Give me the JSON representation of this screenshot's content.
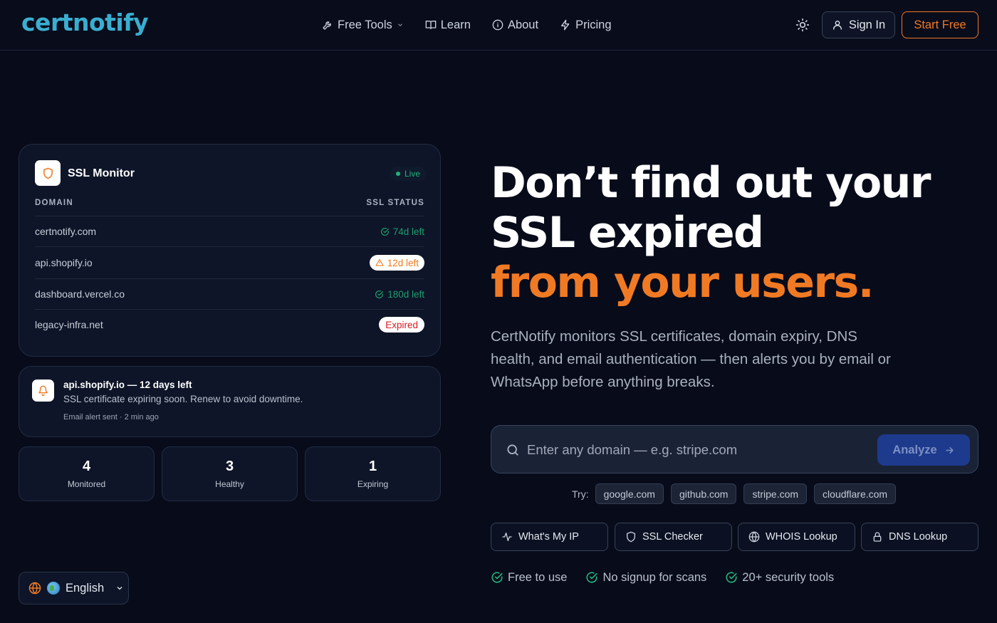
{
  "header": {
    "logo": "certnotify",
    "nav": [
      {
        "label": "Free Tools",
        "icon": "wrench-icon",
        "has_dropdown": true
      },
      {
        "label": "Learn",
        "icon": "book-icon"
      },
      {
        "label": "About",
        "icon": "info-icon"
      },
      {
        "label": "Pricing",
        "icon": "bolt-icon"
      }
    ],
    "sign_in": "Sign In",
    "start_free": "Start Free"
  },
  "monitor": {
    "title": "SSL Monitor",
    "live": "Live",
    "col_domain": "DOMAIN",
    "col_status": "SSL STATUS",
    "rows": [
      {
        "domain": "certnotify.com",
        "status": "74d left",
        "kind": "ok"
      },
      {
        "domain": "api.shopify.io",
        "status": "12d left",
        "kind": "warn"
      },
      {
        "domain": "dashboard.vercel.co",
        "status": "180d left",
        "kind": "ok"
      },
      {
        "domain": "legacy-infra.net",
        "status": "Expired",
        "kind": "expired"
      }
    ]
  },
  "alert": {
    "title": "api.shopify.io — 12 days left",
    "message": "SSL certificate expiring soon. Renew to avoid downtime.",
    "meta": "Email alert sent · 2 min ago"
  },
  "stats": [
    {
      "value": "4",
      "label": "Monitored"
    },
    {
      "value": "3",
      "label": "Healthy"
    },
    {
      "value": "1",
      "label": "Expiring"
    }
  ],
  "language": {
    "label": "English"
  },
  "hero": {
    "line1": "Don’t find out your",
    "line2": "SSL expired",
    "accent": "from your users.",
    "subtitle": "CertNotify monitors SSL certificates, domain expiry, DNS health, and email authentication — then alerts you by email or WhatsApp before anything breaks."
  },
  "search": {
    "placeholder": "Enter any domain — e.g. stripe.com",
    "button": "Analyze"
  },
  "try": {
    "label": "Try:",
    "chips": [
      "google.com",
      "github.com",
      "stripe.com",
      "cloudflare.com"
    ]
  },
  "tools": [
    {
      "label": "What's My IP",
      "icon": "activity-icon"
    },
    {
      "label": "SSL Checker",
      "icon": "shield-icon"
    },
    {
      "label": "WHOIS Lookup",
      "icon": "globe-icon"
    },
    {
      "label": "DNS Lookup",
      "icon": "lock-icon"
    }
  ],
  "features": [
    "Free to use",
    "No signup for scans",
    "20+ security tools"
  ],
  "colors": {
    "background": "#070b1a",
    "accent_orange": "#f07a24",
    "logo_blue": "#3aaed0",
    "success_green": "#1f9d6e",
    "danger_red": "#d81c24",
    "button_blue": "#1d3a8c"
  }
}
